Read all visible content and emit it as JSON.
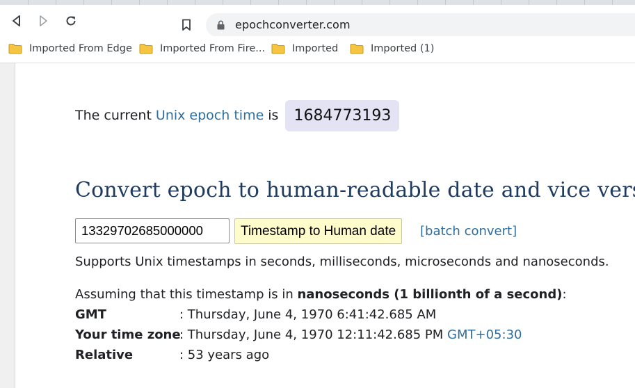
{
  "browser": {
    "url": "epochconverter.com",
    "bookmarks": [
      {
        "label": "Imported From Edge",
        "icon": "folder-icon"
      },
      {
        "label": "Imported From Fire...",
        "icon": "folder-icon"
      },
      {
        "label": "Imported",
        "icon": "folder-icon"
      },
      {
        "label": "Imported (1)",
        "icon": "folder-icon"
      }
    ]
  },
  "current": {
    "prefix": "The current",
    "link": "Unix epoch time",
    "suffix": "is",
    "value": "1684773193"
  },
  "converter": {
    "title": "Convert epoch to human-readable date and vice versa",
    "input_value": "13329702685000000",
    "button_label": "Timestamp to Human date",
    "batch_link": "[batch convert]",
    "supports": "Supports Unix timestamps in seconds, milliseconds, microseconds and nanoseconds."
  },
  "result": {
    "assume_prefix": "Assuming that this timestamp is in ",
    "assume_bold": "nanoseconds (1 billionth of a second)",
    "assume_suffix": ":",
    "gmt_label": "GMT",
    "gmt_value": ": Thursday, June 4, 1970 6:41:42.685 AM",
    "tz_label": "Your time zone",
    "tz_value": ": Thursday, June 4, 1970 12:11:42.685 PM",
    "tz_offset": "GMT+05:30",
    "rel_label": "Relative",
    "rel_value": ": 53 years ago"
  },
  "colors": {
    "link": "#2e6d9c",
    "title": "#1f3a5f",
    "button_bg": "#fffccc",
    "epoch_box": "#e3e3f4"
  }
}
